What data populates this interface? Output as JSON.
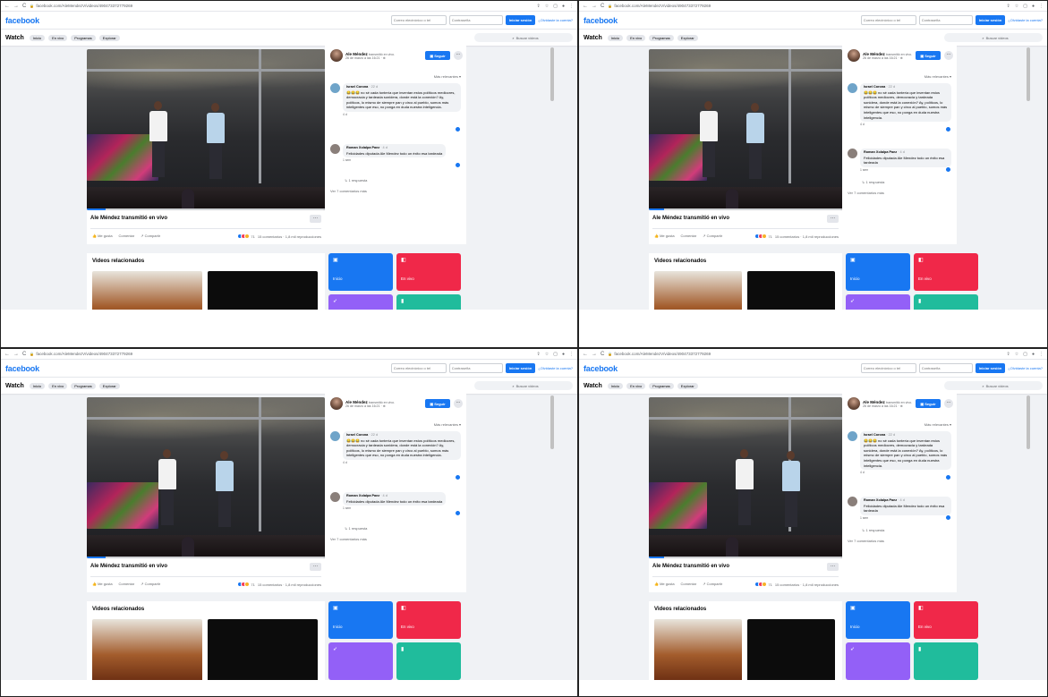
{
  "browser": {
    "nav_back": "←",
    "nav_forward": "→",
    "nav_reload": "C",
    "url": "facebook.com/AleMendezV/videos/490473372779269",
    "icons": [
      "share-icon",
      "star-icon",
      "tab-icon",
      "profile-icon",
      "menu-icon"
    ]
  },
  "topbar": {
    "logo": "facebook",
    "email_placeholder": "Correo electrónico o tel",
    "password_placeholder": "Contraseña",
    "login_label": "Iniciar sesión",
    "forgot_label": "¿Olvidaste la cuenta?"
  },
  "watch": {
    "title": "Watch",
    "tabs": [
      "Inicio",
      "En vivo",
      "Programas",
      "Explorar"
    ],
    "search_placeholder": "Buscar videos"
  },
  "post": {
    "title": "Ale Méndez transmitió en vivo",
    "actions": [
      "Me gusta",
      "Comentar",
      "Compartir"
    ],
    "stats": "15 comentarios · 1,8 mil reproducciones",
    "reactions_count": "71"
  },
  "side": {
    "channel_name": "Ale Méndez",
    "channel_action": "transmitió en vivo.",
    "channel_date": "26 de marzo a las 16:21 · ⊕",
    "follow_label": "Seguir",
    "sort_label": "Más relevantes ▾",
    "comments": [
      {
        "author": "Israel Corona",
        "time": "· 22 d",
        "text": "😂😂😂 no sé cada tontería que inventan estos políticos mediocres, democracia y tardeada sonidera, donde está la conexión? Ay, políticos, lo mismo de siempre pan y circo al pueblo, somos más inteligentes que eso, no ponga en duda nuestra inteligencia.",
        "meta": "4 d"
      },
      {
        "author": "Roman Xolalpa Paez",
        "time": "· 4 d",
        "text": "Felicidades diputada Ale Mendez todo un éxito esa tardeada",
        "meta": "1 sem"
      }
    ],
    "replies_label": "↳ 1 respuesta",
    "more_comments": "Ver 7 comentarios más"
  },
  "related": {
    "title": "Videos relacionados",
    "tiles": [
      "Inicio",
      "En vivo"
    ]
  },
  "colors": {
    "accent": "#1877f2",
    "live": "#f02849",
    "page_bg": "#f0f2f5"
  }
}
